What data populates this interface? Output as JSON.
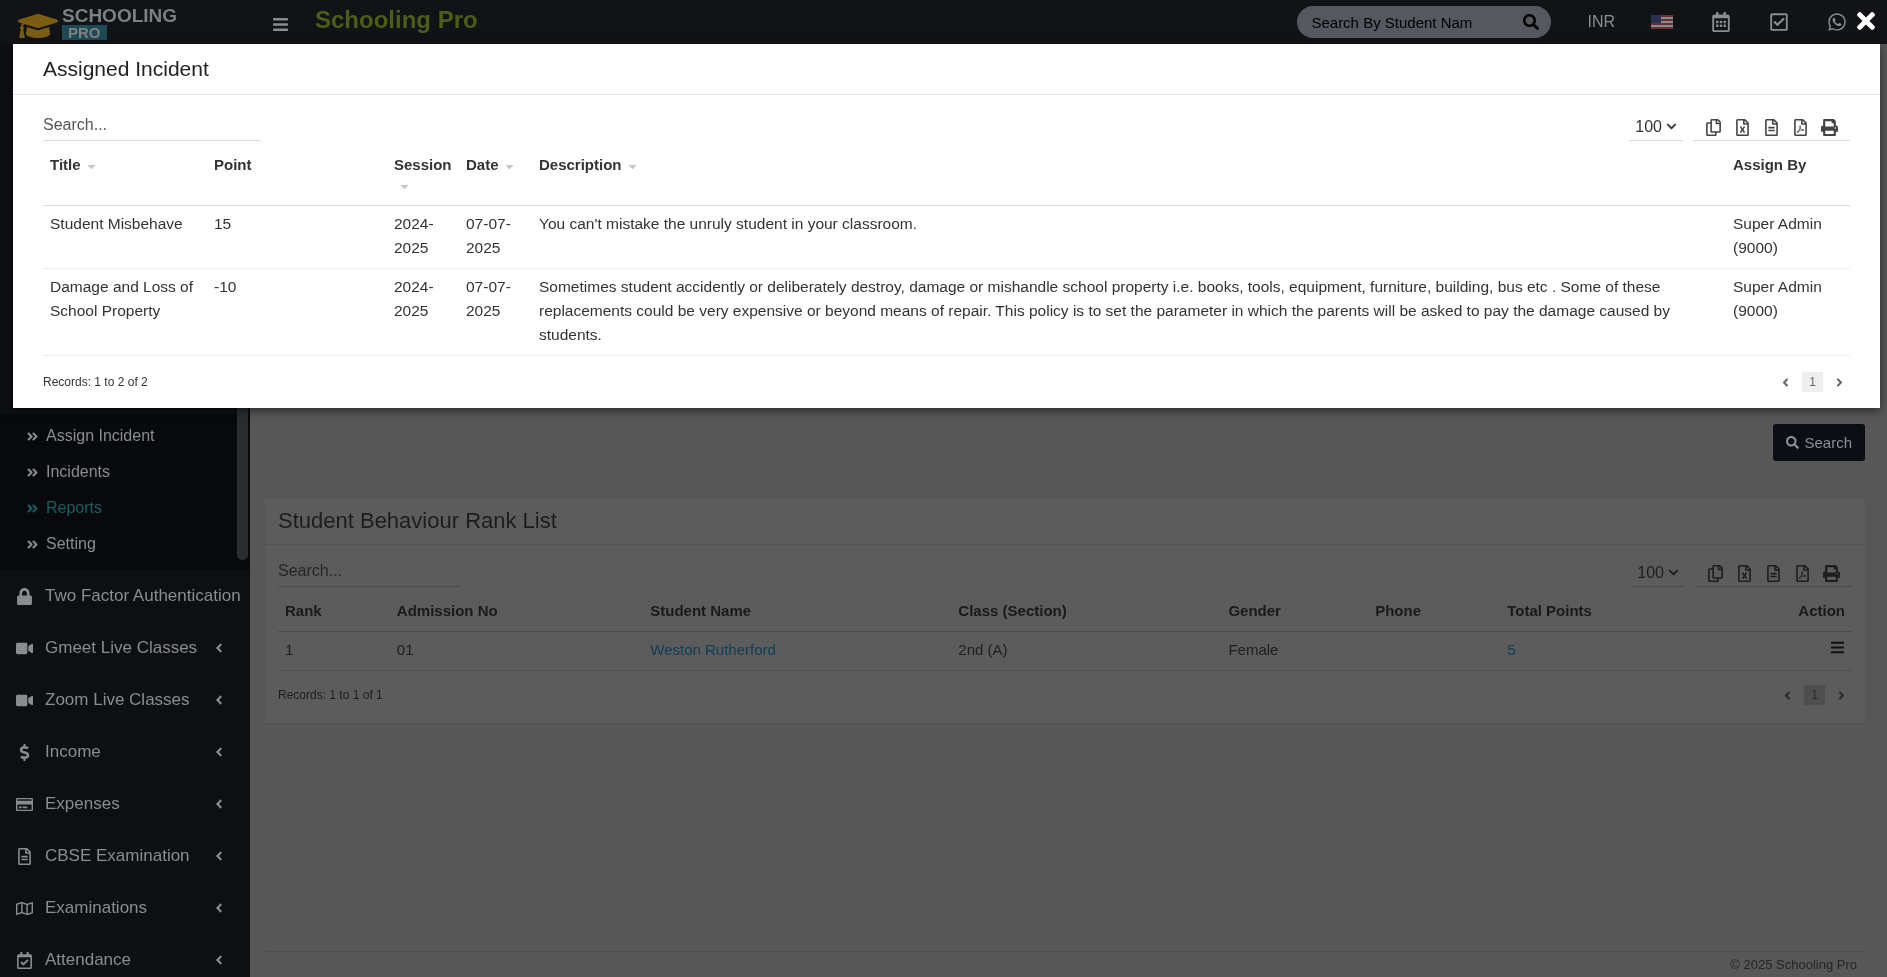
{
  "header": {
    "logo_top": "SCHOOLING",
    "logo_bottom": "PRO",
    "app_name": "Schooling Pro",
    "search": {
      "placeholder": "Search By Student Nam"
    },
    "currency": "INR"
  },
  "sidebar": {
    "submenu": [
      {
        "label": "Assign Incident",
        "selected": false
      },
      {
        "label": "Incidents",
        "selected": false
      },
      {
        "label": "Reports",
        "selected": true
      },
      {
        "label": "Setting",
        "selected": false
      }
    ],
    "items": [
      {
        "label": "Two Factor Authentication"
      },
      {
        "label": "Gmeet Live Classes"
      },
      {
        "label": "Zoom Live Classes"
      },
      {
        "label": "Income"
      },
      {
        "label": "Expenses"
      },
      {
        "label": "CBSE Examination"
      },
      {
        "label": "Examinations"
      },
      {
        "label": "Attendance"
      }
    ]
  },
  "filter_panel": {
    "search_button": "Search"
  },
  "rank_list": {
    "title": "Student Behaviour Rank List",
    "search": {
      "placeholder": "Search..."
    },
    "page_size": "100",
    "columns": [
      "Rank",
      "Admission No",
      "Student Name",
      "Class (Section)",
      "Gender",
      "Phone",
      "Total Points",
      "Action"
    ],
    "rows": [
      {
        "rank": "1",
        "admission_no": "01",
        "student_name": "Weston Rutherford",
        "class_section": "2nd (A)",
        "gender": "Female",
        "total_points": "5"
      }
    ],
    "records": "Records: 1 to 1 of 1",
    "pages": [
      {
        "label": "1",
        "selected": true
      }
    ]
  },
  "footer": "© 2025 Schooling Pro",
  "modal": {
    "title": "Assigned Incident",
    "search": {
      "placeholder": "Search..."
    },
    "page_size": "100",
    "columns": [
      {
        "label": "Title",
        "sortable": true
      },
      {
        "label": "Point",
        "sortable": false
      },
      {
        "label": "Session",
        "sortable": true
      },
      {
        "label": "Date",
        "sortable": true
      },
      {
        "label": "Description",
        "sortable": true
      },
      {
        "label": "Assign By",
        "sortable": false
      }
    ],
    "rows": [
      [
        "Student Misbehave",
        "15",
        "2024-2025",
        "07-07-2025",
        "You can't mistake the unruly student in your classroom.",
        "Super Admin (9000)"
      ],
      [
        "Damage and Loss of School Property",
        "-10",
        "2024-2025",
        "07-07-2025",
        "Sometimes student accidently or deliberately destroy, damage or mishandle school property i.e. books, tools, equipment, furniture, building, bus etc . Some of these replacements could be very expensive or beyond means of repair. This policy is to set the parameter in which the parents will be asked to pay the damage caused by students.",
        "Super Admin (9000)"
      ]
    ],
    "records": "Records: 1 to 2 of 2",
    "pages": [
      {
        "label": "1",
        "selected": true
      }
    ]
  }
}
